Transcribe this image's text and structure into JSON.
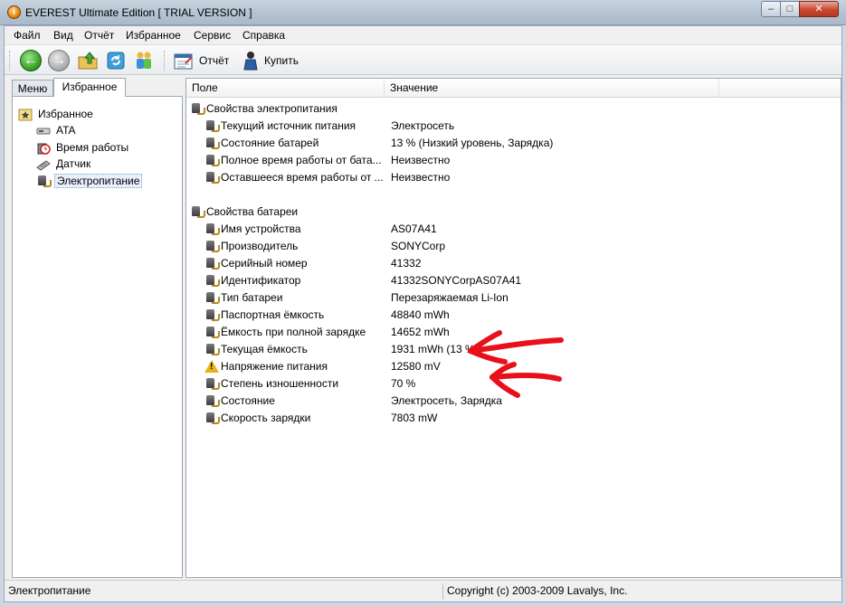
{
  "window": {
    "title": "EVEREST Ultimate Edition  [ TRIAL VERSION ]",
    "controls": {
      "minimize": "–",
      "maximize": "□",
      "close": "✕"
    }
  },
  "menu": [
    "Файл",
    "Вид",
    "Отчёт",
    "Избранное",
    "Сервис",
    "Справка"
  ],
  "toolbar": {
    "report_label": "Отчёт",
    "buy_label": "Купить",
    "icons": [
      "back-icon",
      "forward-icon",
      "up-folder-icon",
      "refresh-icon",
      "users-icon",
      "report-icon",
      "buy-icon"
    ]
  },
  "tabs": {
    "menu": "Меню",
    "favorites": "Избранное"
  },
  "tree": {
    "root": "Избранное",
    "items": [
      "ATA",
      "Время работы",
      "Датчик",
      "Электропитание"
    ]
  },
  "list": {
    "columns": [
      "Поле",
      "Значение"
    ],
    "groups": [
      {
        "title": "Свойства электропитания",
        "rows": [
          {
            "field": "Текущий источник питания",
            "value": "Электросеть",
            "icon": "plug-icon"
          },
          {
            "field": "Состояние батарей",
            "value": "13 % (Низкий уровень, Зарядка)",
            "icon": "plug-icon"
          },
          {
            "field": "Полное время работы от бата...",
            "value": "Неизвестно",
            "icon": "plug-icon"
          },
          {
            "field": "Оставшееся время работы от ...",
            "value": "Неизвестно",
            "icon": "plug-icon"
          }
        ]
      },
      {
        "title": "Свойства батареи",
        "rows": [
          {
            "field": "Имя устройства",
            "value": "AS07A41",
            "icon": "plug-icon"
          },
          {
            "field": "Производитель",
            "value": "SONYCorp",
            "icon": "plug-icon"
          },
          {
            "field": "Серийный номер",
            "value": "41332",
            "icon": "plug-icon"
          },
          {
            "field": "Идентификатор",
            "value": "41332SONYCorpAS07A41",
            "icon": "plug-icon"
          },
          {
            "field": "Тип батареи",
            "value": "Перезаряжаемая Li-Ion",
            "icon": "plug-icon"
          },
          {
            "field": "Паспортная ёмкость",
            "value": "48840 mWh",
            "icon": "plug-icon"
          },
          {
            "field": "Ёмкость при полной зарядке",
            "value": "14652 mWh",
            "icon": "plug-icon"
          },
          {
            "field": "Текущая ёмкость",
            "value": "1931 mWh  (13 %)",
            "icon": "plug-icon"
          },
          {
            "field": "Напряжение питания",
            "value": "12580 mV",
            "icon": "warning-icon"
          },
          {
            "field": "Степень изношенности",
            "value": "70 %",
            "icon": "plug-icon"
          },
          {
            "field": "Состояние",
            "value": "Электросеть, Зарядка",
            "icon": "plug-icon"
          },
          {
            "field": "Скорость зарядки",
            "value": "7803 mW",
            "icon": "plug-icon"
          }
        ]
      }
    ]
  },
  "status": {
    "left": "Электропитание",
    "right": "Copyright (c) 2003-2009 Lavalys, Inc."
  },
  "colors": {
    "annotation_arrow": "#e8101a",
    "selection": "#e8f0fb"
  }
}
